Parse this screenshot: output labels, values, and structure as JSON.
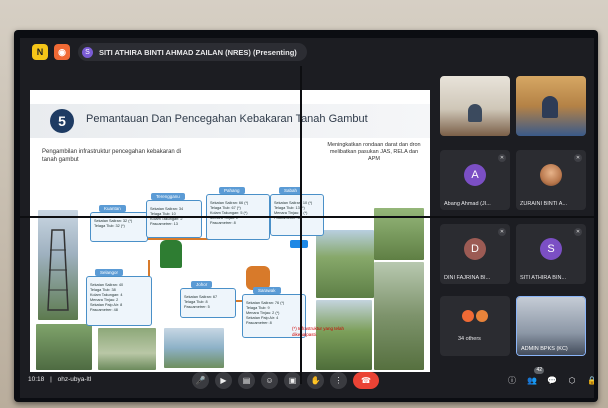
{
  "app": {
    "logo_letter": "N",
    "logo2_symbol": "◉",
    "colors": {
      "logo": "#f5c518",
      "logo2": "#f06a35",
      "end_call": "#ea4335",
      "slide_accent": "#1e3b63"
    }
  },
  "presenter": {
    "initial": "S",
    "label": "SITI ATHIRA BINTI AHMAD ZAILAN (NRES) (Presenting)"
  },
  "slide": {
    "number": "5",
    "title": "Pemantauan Dan Pencegahan Kebakaran Tanah Gambut",
    "subtitle": "Pengambilan infrastruktur pencegahan kebakaran di tanah gambut",
    "right_text": "Meningkatkan rondaan darat dan dron melibatkan pasukan JAS, RELA dan APM",
    "footnote": "(*) Infrastruktur yang telah dikenalpasti.",
    "boxes": [
      {
        "header": "Kuantan",
        "lines": [
          "Sekatan Saliran: 32 (*)",
          "Telaga Tiub: 32 (*)"
        ]
      },
      {
        "header": "Terengganu",
        "lines": [
          "Sekatan Saliran: 34",
          "Telaga Tiub: 10",
          "Kolam Takungan: 2",
          "Pascametrer: 13"
        ]
      },
      {
        "header": "Pahang",
        "lines": [
          "Sekatan Saliran: 66 (*)",
          "Telaga Tiub: 67 (*)",
          "Kolam Takungan: 5 (*)",
          "Menara Tinjau: 2",
          "Pascametrer: 8"
        ]
      },
      {
        "header": "Sabah",
        "lines": [
          "Sekatan Saliran: 10 (*)",
          "Telaga Tiub: 13 (*)",
          "Menara Tinjau: 1 (*)",
          "Pascametrer: 8"
        ]
      },
      {
        "header": "Selangor",
        "lines": [
          "Sekatan Saliran: 40",
          "Telaga Tiub: 38",
          "Kolam Takungan: 4",
          "Menara Tinjau: 2",
          "Sekatan Paip Air: 8",
          "Pascametrer: 48"
        ]
      },
      {
        "header": "Johor",
        "lines": [
          "Sekatan Saliran: 67",
          "Telaga Tiub: 8",
          "Pascametrer: 5"
        ]
      },
      {
        "header": "Sarawak",
        "lines": [
          "Sekatan Saliran: 76 (*)",
          "Telaga Tiub: 9",
          "Menara Tinjau: 2 (*)",
          "Sekatan Paip Air: 4",
          "Pascametrer: 8"
        ]
      }
    ]
  },
  "participants": [
    {
      "name": "",
      "type": "video"
    },
    {
      "name": "",
      "type": "video"
    },
    {
      "name": "Abang Ahmad (JI...",
      "initial": "A",
      "color": "#7b4fc4",
      "type": "avatar"
    },
    {
      "name": "ZURAINI BINTI A...",
      "type": "photo"
    },
    {
      "name": "DINI FAJRINA BI...",
      "initial": "D",
      "color": "#9c5b54",
      "type": "avatar"
    },
    {
      "name": "SITI ATHIRA BIN...",
      "initial": "S",
      "color": "#7b4fc4",
      "type": "avatar"
    },
    {
      "name": "34 others",
      "type": "others"
    },
    {
      "name": "ADMIN BPKS (KC)",
      "type": "video"
    }
  ],
  "meeting": {
    "time": "10:18",
    "code": "ohz-ubya-ltl",
    "participant_count": "42"
  }
}
